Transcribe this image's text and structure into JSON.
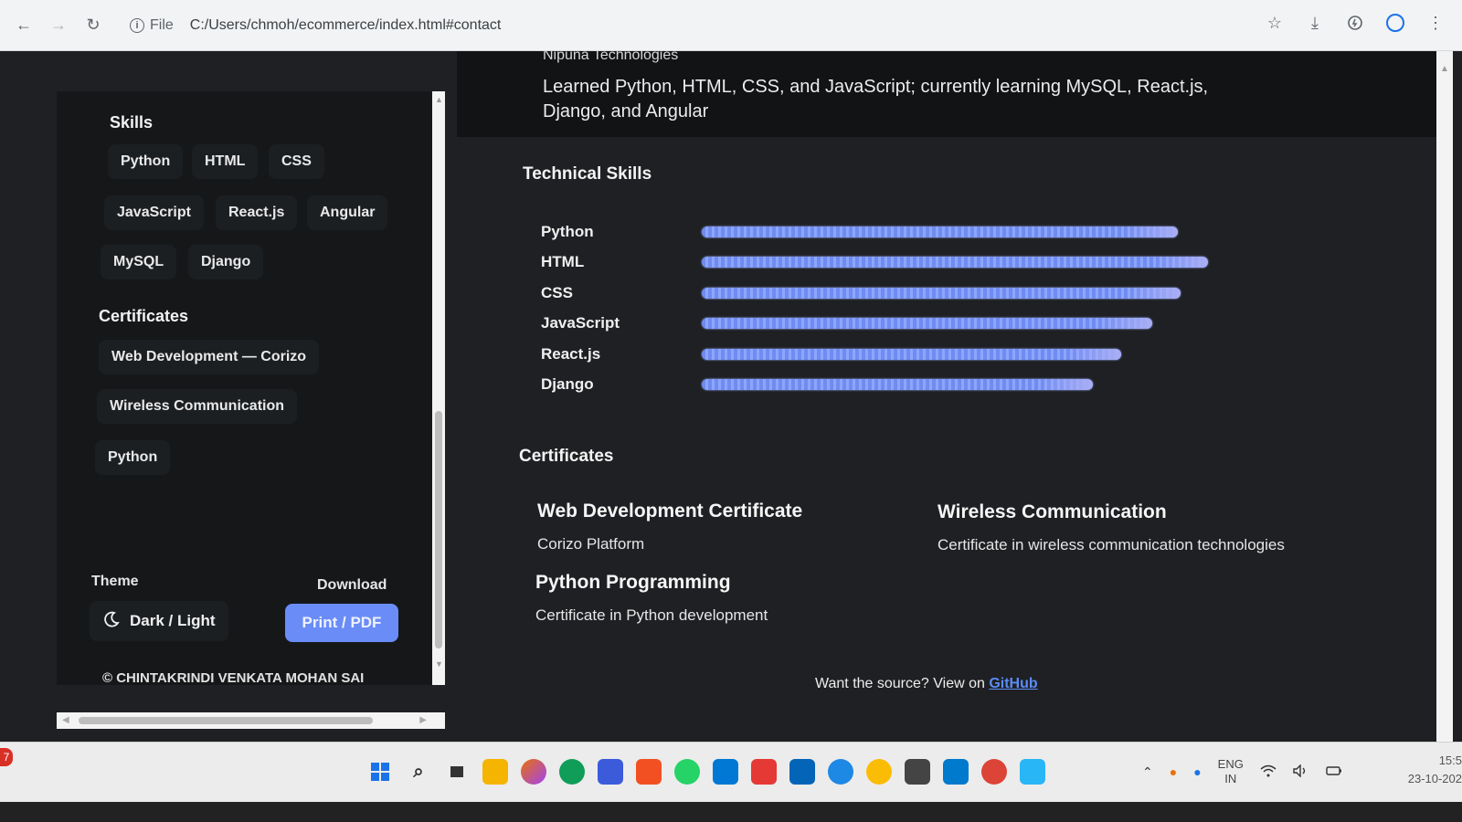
{
  "browser": {
    "back_icon": "←",
    "forward_icon": "→",
    "reload_icon": "↻",
    "info_icon": "i",
    "file_label": "File",
    "url": "C:/Users/chmoh/ecommerce/index.html#contact",
    "star_icon": "☆",
    "download_icon": "⤓",
    "menu_icon": "⋮"
  },
  "sidebar": {
    "skills_title": "Skills",
    "skills": [
      "Python",
      "HTML",
      "CSS",
      "JavaScript",
      "React.js",
      "Angular",
      "MySQL",
      "Django"
    ],
    "certificates_title": "Certificates",
    "certificates": [
      "Web Development — Corizo",
      "Wireless Communication",
      "Python"
    ],
    "theme_label": "Theme",
    "download_label": "Download",
    "theme_button": "Dark / Light",
    "print_button": "Print / PDF",
    "copyright": "© CHINTAKRINDI VENKATA MOHAN SAI",
    "accent_color": "#6a8cf7"
  },
  "main": {
    "company": "Nipuna Technologies",
    "description": "Learned Python, HTML, CSS, and JavaScript; currently learning MySQL, React.js, Django, and Angular",
    "technical_skills_title": "Technical Skills",
    "skill_bars": [
      {
        "name": "Python",
        "level": 0.93
      },
      {
        "name": "HTML",
        "level": 0.99
      },
      {
        "name": "CSS",
        "level": 0.935
      },
      {
        "name": "JavaScript",
        "level": 0.88
      },
      {
        "name": "React.js",
        "level": 0.82
      },
      {
        "name": "Django",
        "level": 0.765
      }
    ],
    "certificates_title": "Certificates",
    "certificates": [
      {
        "title": "Web Development Certificate",
        "subtitle": "Corizo Platform"
      },
      {
        "title": "Wireless Communication",
        "subtitle": "Certificate in wireless communication technologies"
      },
      {
        "title": "Python Programming",
        "subtitle": "Certificate in Python development"
      }
    ],
    "footer_text": "Want the source? View on ",
    "footer_link": "GitHub"
  },
  "taskbar": {
    "notification_count": "7",
    "lang_primary": "ENG",
    "lang_secondary": "IN",
    "time": "15:5",
    "date": "23-10-202"
  }
}
